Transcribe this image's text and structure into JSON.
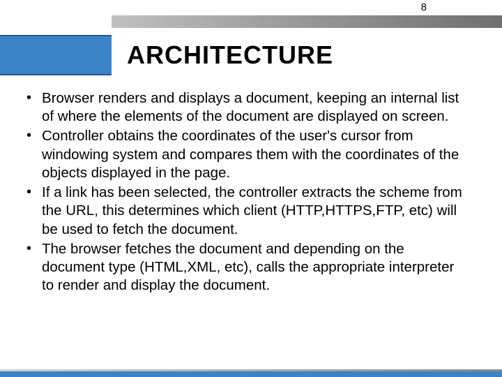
{
  "page_number": "8",
  "title": "ARCHITECTURE",
  "bullets": [
    "Browser renders and displays a document, keeping an internal list of where the elements of the document are displayed on screen.",
    "Controller obtains the coordinates of the user's cursor from windowing system and compares them with the coordinates of the objects displayed in the page.",
    "If a link has been selected, the controller extracts the scheme from the URL, this determines which client (HTTP,HTTPS,FTP, etc) will be used to fetch the document.",
    "The browser fetches the document and depending on the document type (HTML,XML, etc), calls the appropriate interpreter to render and display the document."
  ]
}
